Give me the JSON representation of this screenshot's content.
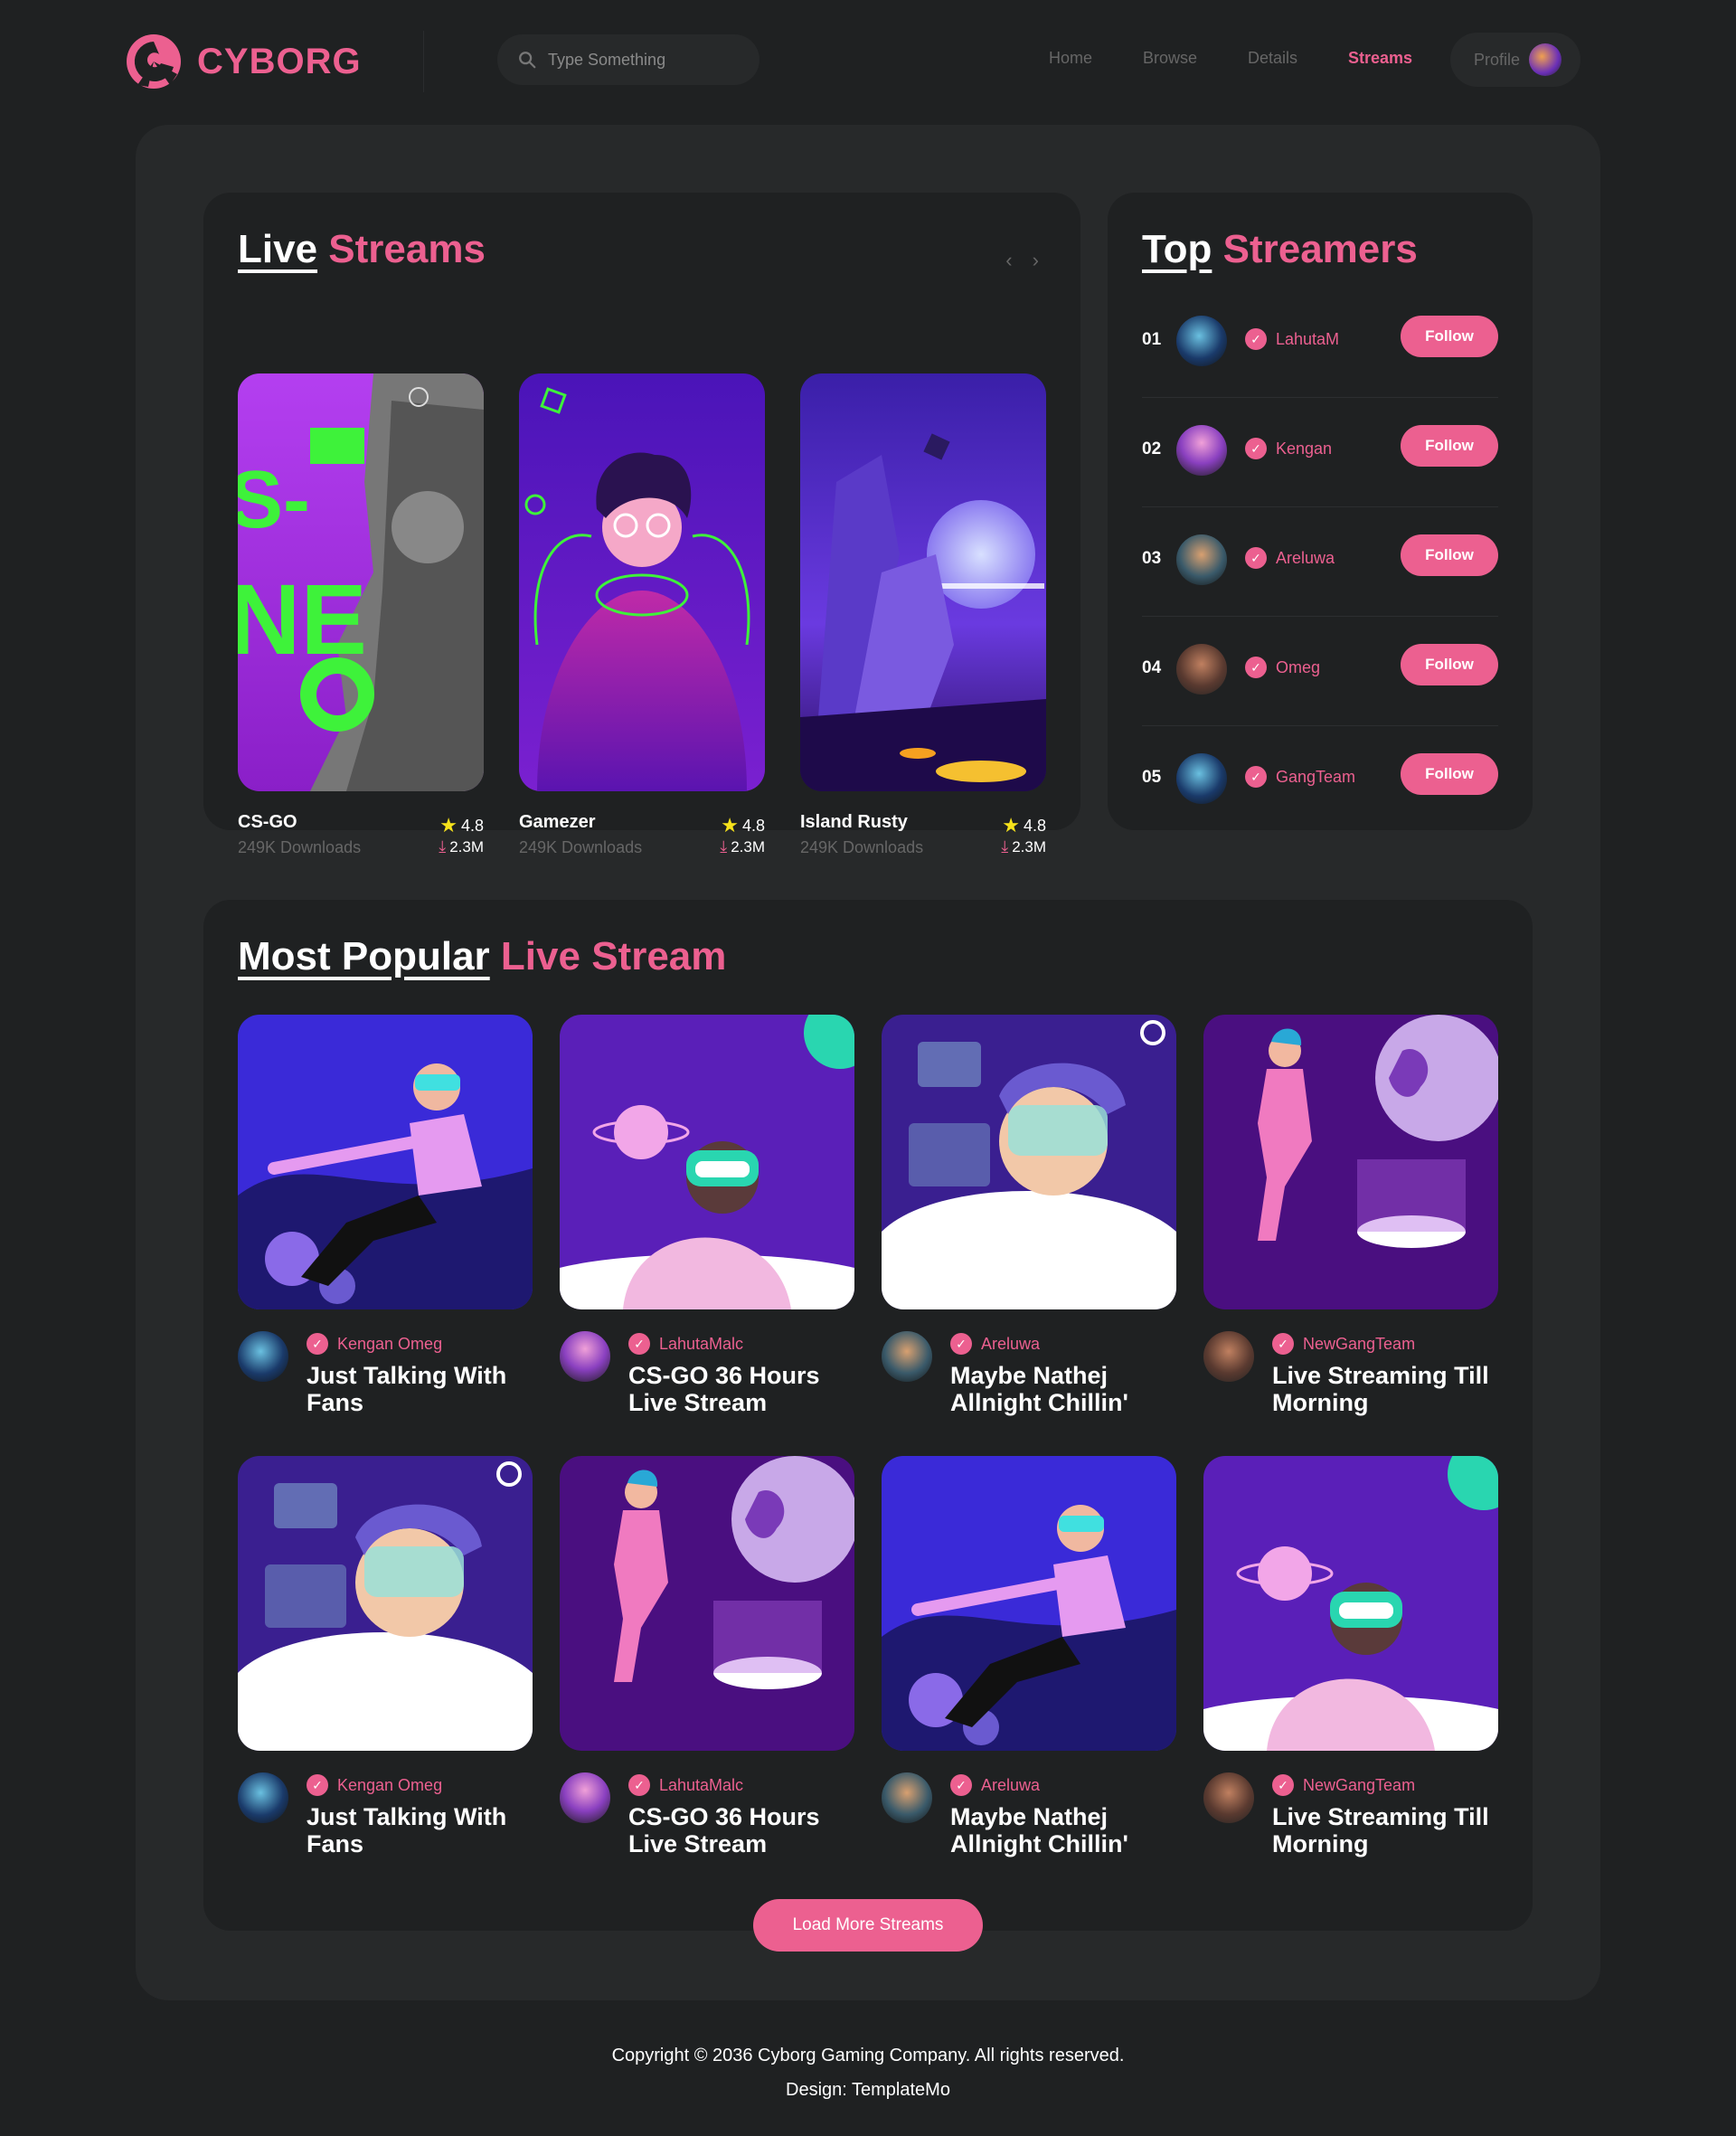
{
  "brand": {
    "name": "CYBORG"
  },
  "search": {
    "placeholder": "Type Something"
  },
  "nav": {
    "items": [
      "Home",
      "Browse",
      "Details",
      "Streams"
    ],
    "active": "Streams",
    "profile_label": "Profile"
  },
  "live_streams": {
    "title_white": "Live",
    "title_pink": "Streams",
    "arrows": "‹ ›",
    "cards": [
      {
        "name": "CS-GO",
        "downloads_label": "249K Downloads",
        "rating": "4.8",
        "count": "2.3M"
      },
      {
        "name": "Gamezer",
        "downloads_label": "249K Downloads",
        "rating": "4.8",
        "count": "2.3M"
      },
      {
        "name": "Island Rusty",
        "downloads_label": "249K Downloads",
        "rating": "4.8",
        "count": "2.3M"
      }
    ]
  },
  "top_streamers": {
    "title_white": "Top",
    "title_pink": "Streamers",
    "items": [
      {
        "rank": "01",
        "name": "LahutaM",
        "button": "Follow"
      },
      {
        "rank": "02",
        "name": "Kengan",
        "button": "Follow"
      },
      {
        "rank": "03",
        "name": "Areluwa",
        "button": "Follow"
      },
      {
        "rank": "04",
        "name": "Omeg",
        "button": "Follow"
      },
      {
        "rank": "05",
        "name": "GangTeam",
        "button": "Follow"
      }
    ]
  },
  "most_popular": {
    "title_white": "Most Popular",
    "title_pink": "Live Stream",
    "cards": [
      {
        "user": "Kengan Omeg",
        "title": "Just Talking With Fans"
      },
      {
        "user": "LahutaMalc",
        "title": "CS-GO 36 Hours Live Stream"
      },
      {
        "user": "Areluwa",
        "title": "Maybe Nathej Allnight Chillin'"
      },
      {
        "user": "NewGangTeam",
        "title": "Live Streaming Till Morning"
      },
      {
        "user": "Kengan Omeg",
        "title": "Just Talking With Fans"
      },
      {
        "user": "LahutaMalc",
        "title": "CS-GO 36 Hours Live Stream"
      },
      {
        "user": "Areluwa",
        "title": "Maybe Nathej Allnight Chillin'"
      },
      {
        "user": "NewGangTeam",
        "title": "Live Streaming Till Morning"
      }
    ],
    "load_more": "Load More Streams"
  },
  "footer": {
    "copyright": "Copyright © 2036 Cyborg Gaming Company. All rights reserved.",
    "design": "Design: TemplateMo"
  },
  "colors": {
    "accent": "#ec6090",
    "background": "#1f2122",
    "panel": "#27292a",
    "muted": "#666666"
  },
  "icons": {
    "search": "search-icon",
    "star": "star-icon",
    "download": "download-icon",
    "verified": "check-icon"
  }
}
